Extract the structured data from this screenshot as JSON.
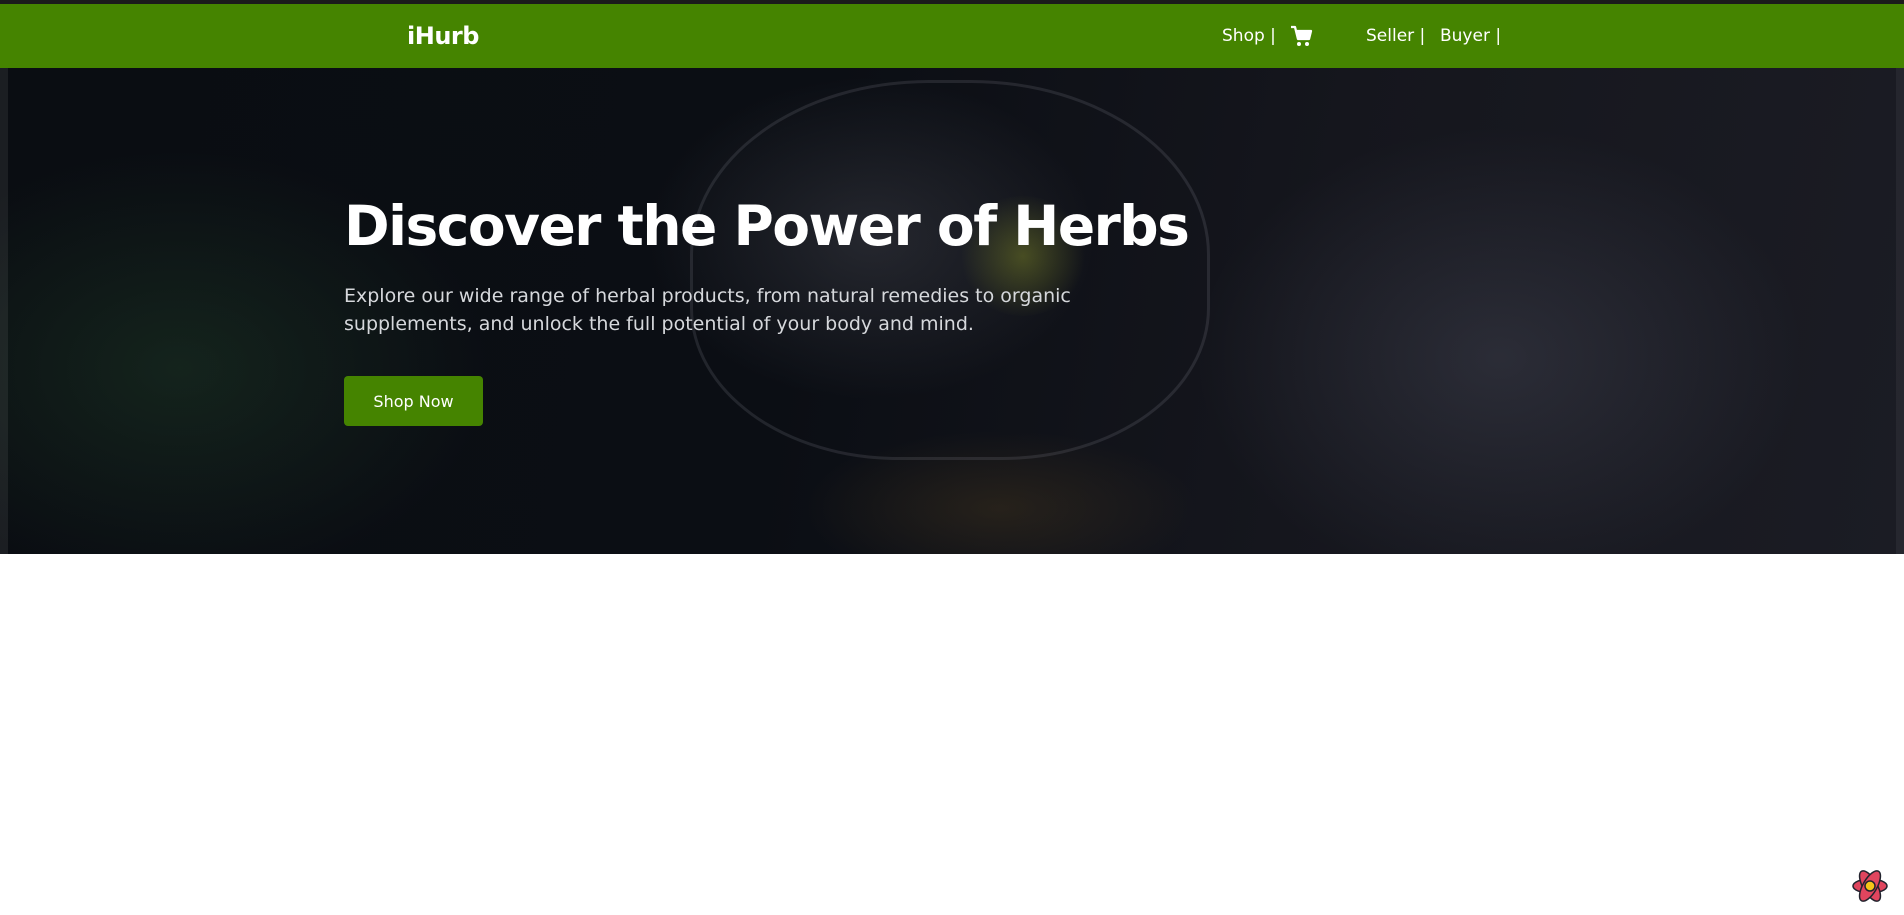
{
  "colors": {
    "navbar": "#458400",
    "button": "#458400",
    "hero_text": "#ffffff",
    "hero_subtext": "#d6d8dc",
    "page_background": "#ffffff"
  },
  "navbar": {
    "brand": "iHurb",
    "links": {
      "shop": "Shop |",
      "seller": "Seller |",
      "buyer": "Buyer |"
    },
    "cart_icon": "shopping-cart-icon"
  },
  "hero": {
    "title": "Discover the Power of Herbs",
    "subtitle": "Explore our wide range of herbal products, from natural remedies to organic supplements, and unlock the full potential of your body and mind.",
    "cta": "Shop Now"
  },
  "floating_widget": {
    "icon": "react-atom-icon"
  }
}
